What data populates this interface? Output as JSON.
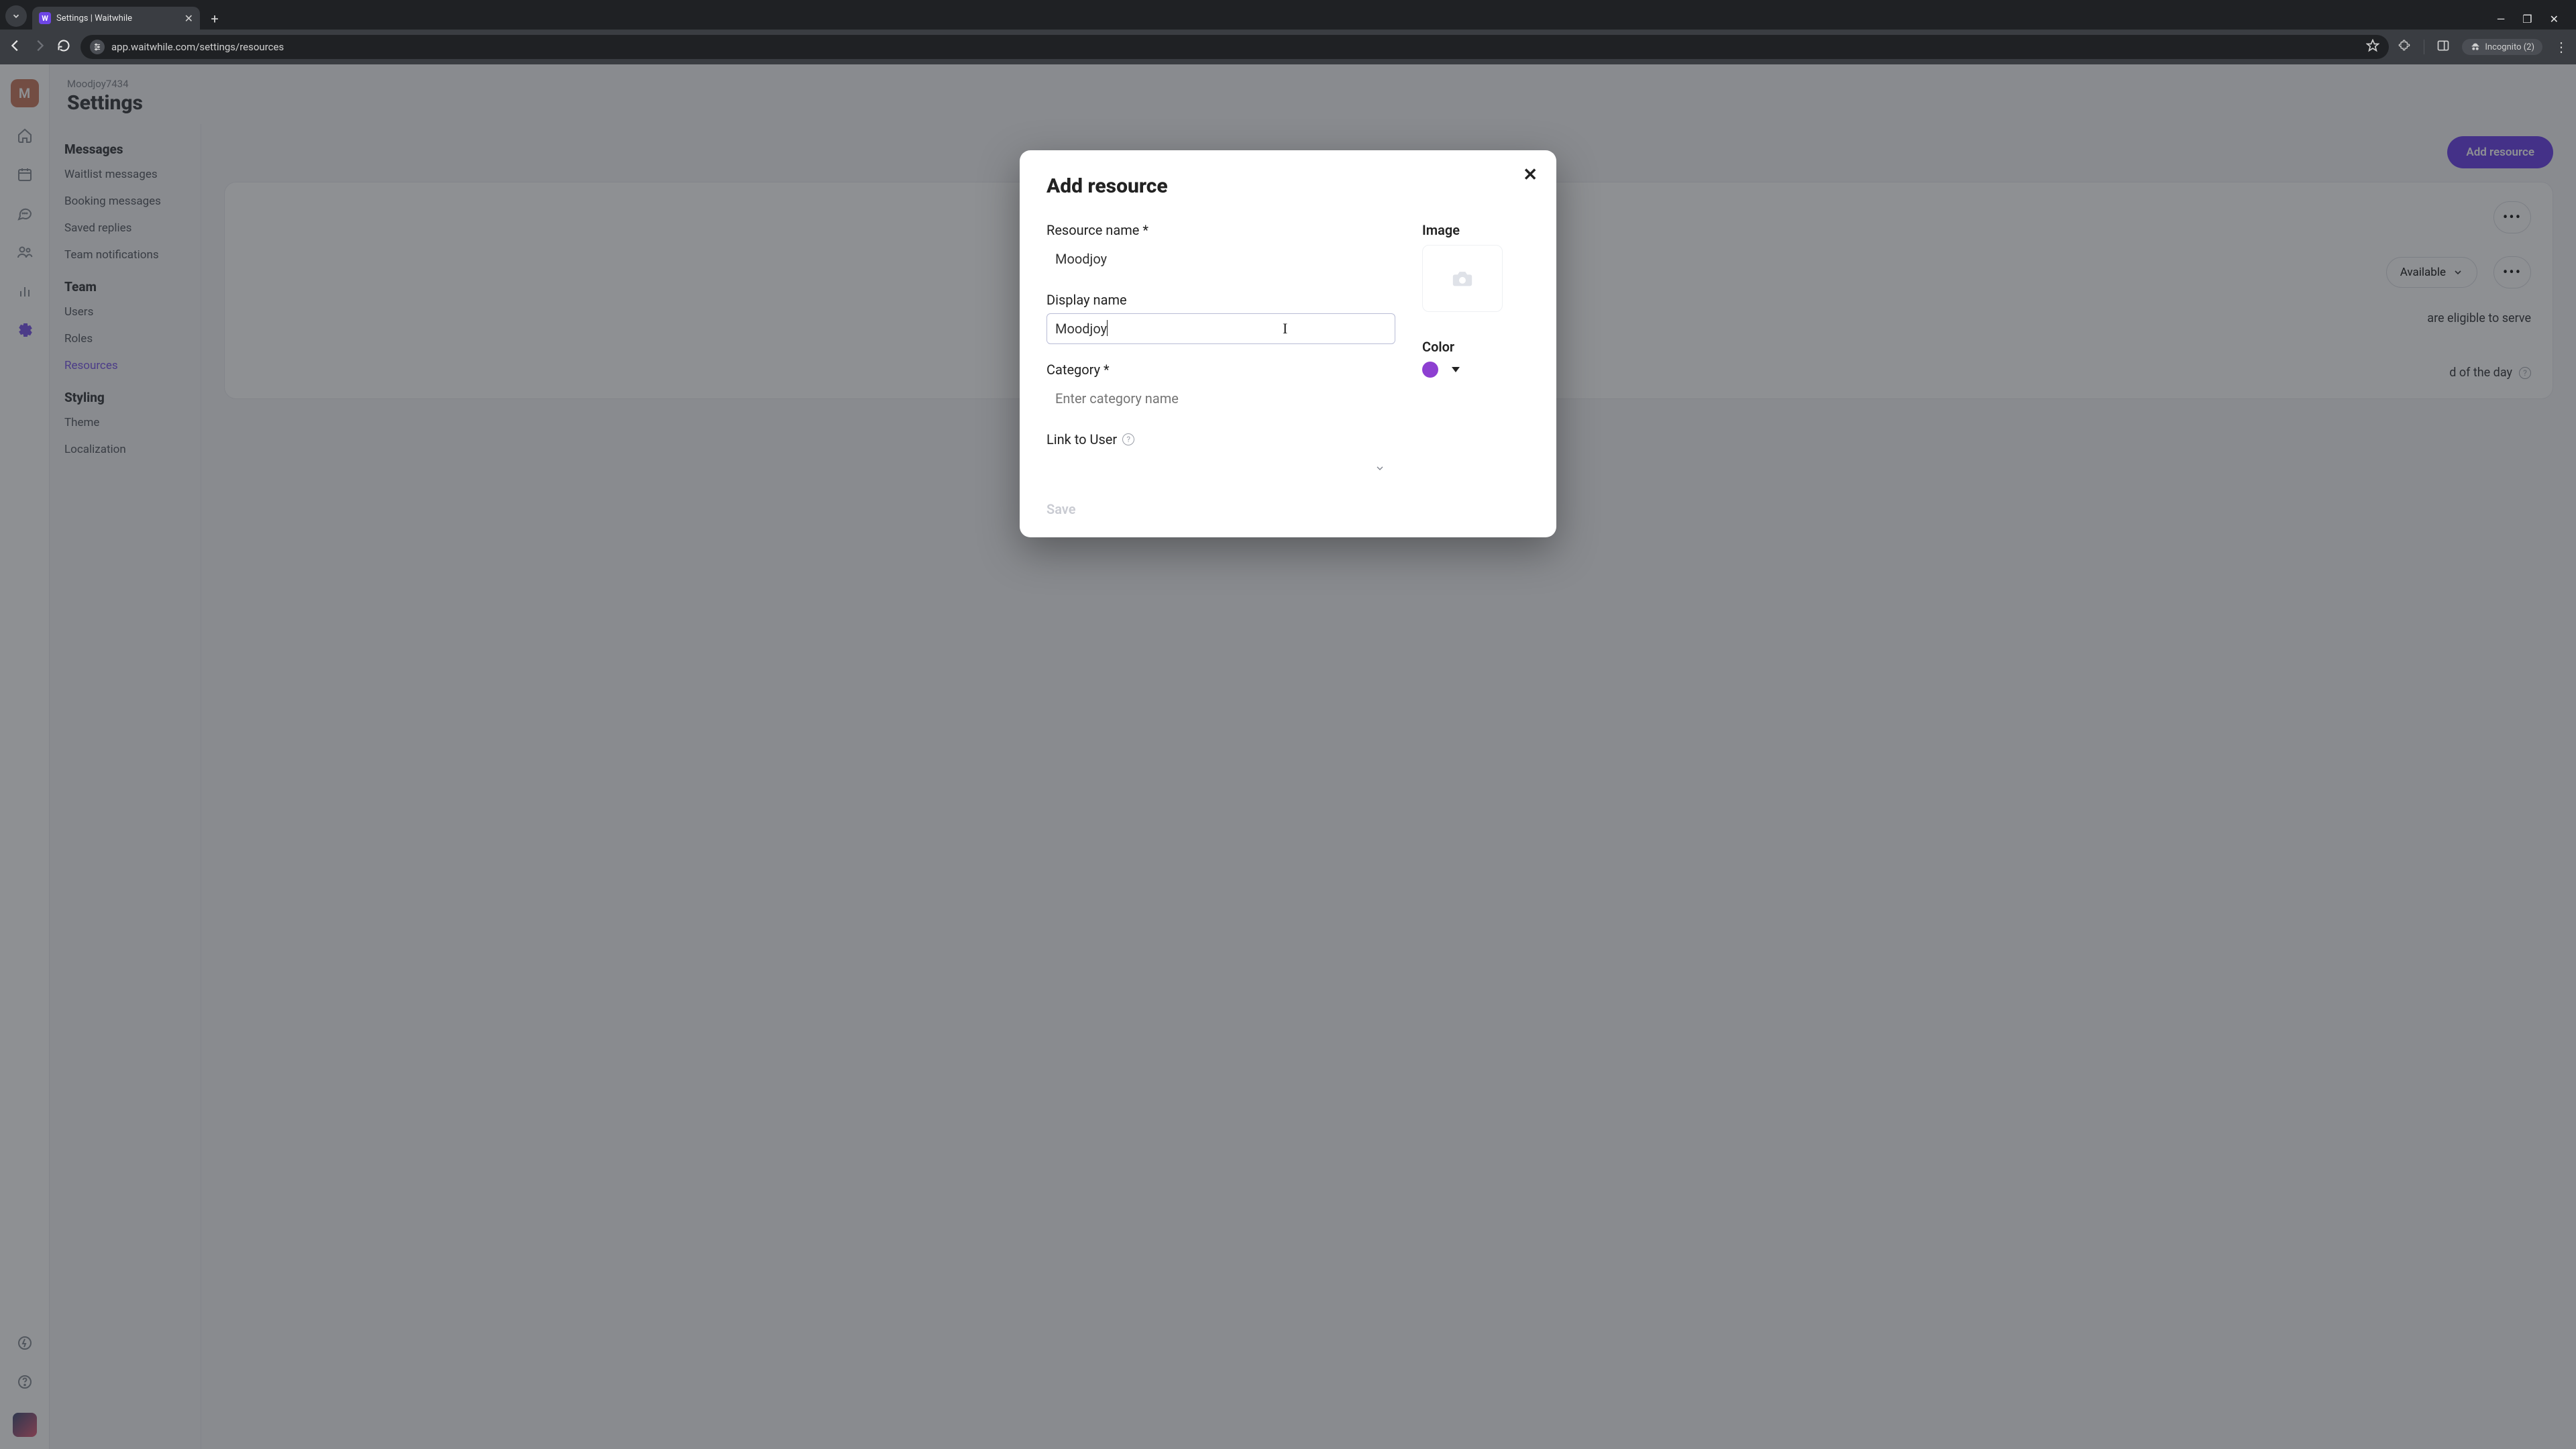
{
  "browser": {
    "tab_title": "Settings | Waitwhile",
    "url": "app.waitwhile.com/settings/resources",
    "incognito_label": "Incognito (2)"
  },
  "header": {
    "workspace": "Moodjoy7434",
    "title": "Settings",
    "logo_letter": "M"
  },
  "settings_nav": {
    "groups": [
      {
        "label": "Messages",
        "items": [
          "Waitlist messages",
          "Booking messages",
          "Saved replies",
          "Team notifications"
        ]
      },
      {
        "label": "Team",
        "items": [
          "Users",
          "Roles",
          "Resources"
        ]
      },
      {
        "label": "Styling",
        "items": [
          "Theme",
          "Localization"
        ]
      }
    ],
    "active_item": "Resources"
  },
  "main": {
    "add_button": "Add resource",
    "availability_label": "Available",
    "line1_fragment": "are eligible to serve",
    "line2_fragment": "d of the day"
  },
  "modal": {
    "title": "Add resource",
    "resource_name_label": "Resource name *",
    "resource_name_value": "Moodjoy",
    "display_name_label": "Display name",
    "display_name_value": "Moodjoy",
    "category_label": "Category *",
    "category_placeholder": "Enter category name",
    "link_user_label": "Link to User",
    "image_label": "Image",
    "color_label": "Color",
    "color_value": "#8d3fd1",
    "save_label": "Save"
  }
}
